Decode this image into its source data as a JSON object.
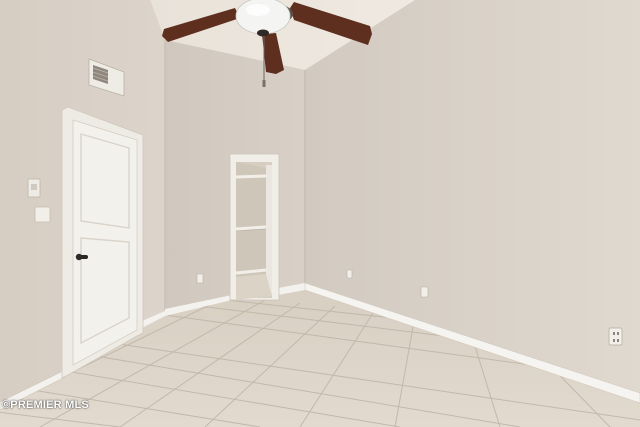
{
  "photo": {
    "watermark": "©PREMIER MLS"
  },
  "colors": {
    "wall_left": "#d9d1c8",
    "wall_center": "#d4ccc2",
    "wall_right": "#dcd4cb",
    "ceiling": "#ece6dd",
    "floor_tile": "#ddd4c8",
    "grout": "#bfb5a8",
    "baseboard": "#f4f2ee",
    "door": "#f3f1ec",
    "fan_blade": "#5e2f1e"
  }
}
